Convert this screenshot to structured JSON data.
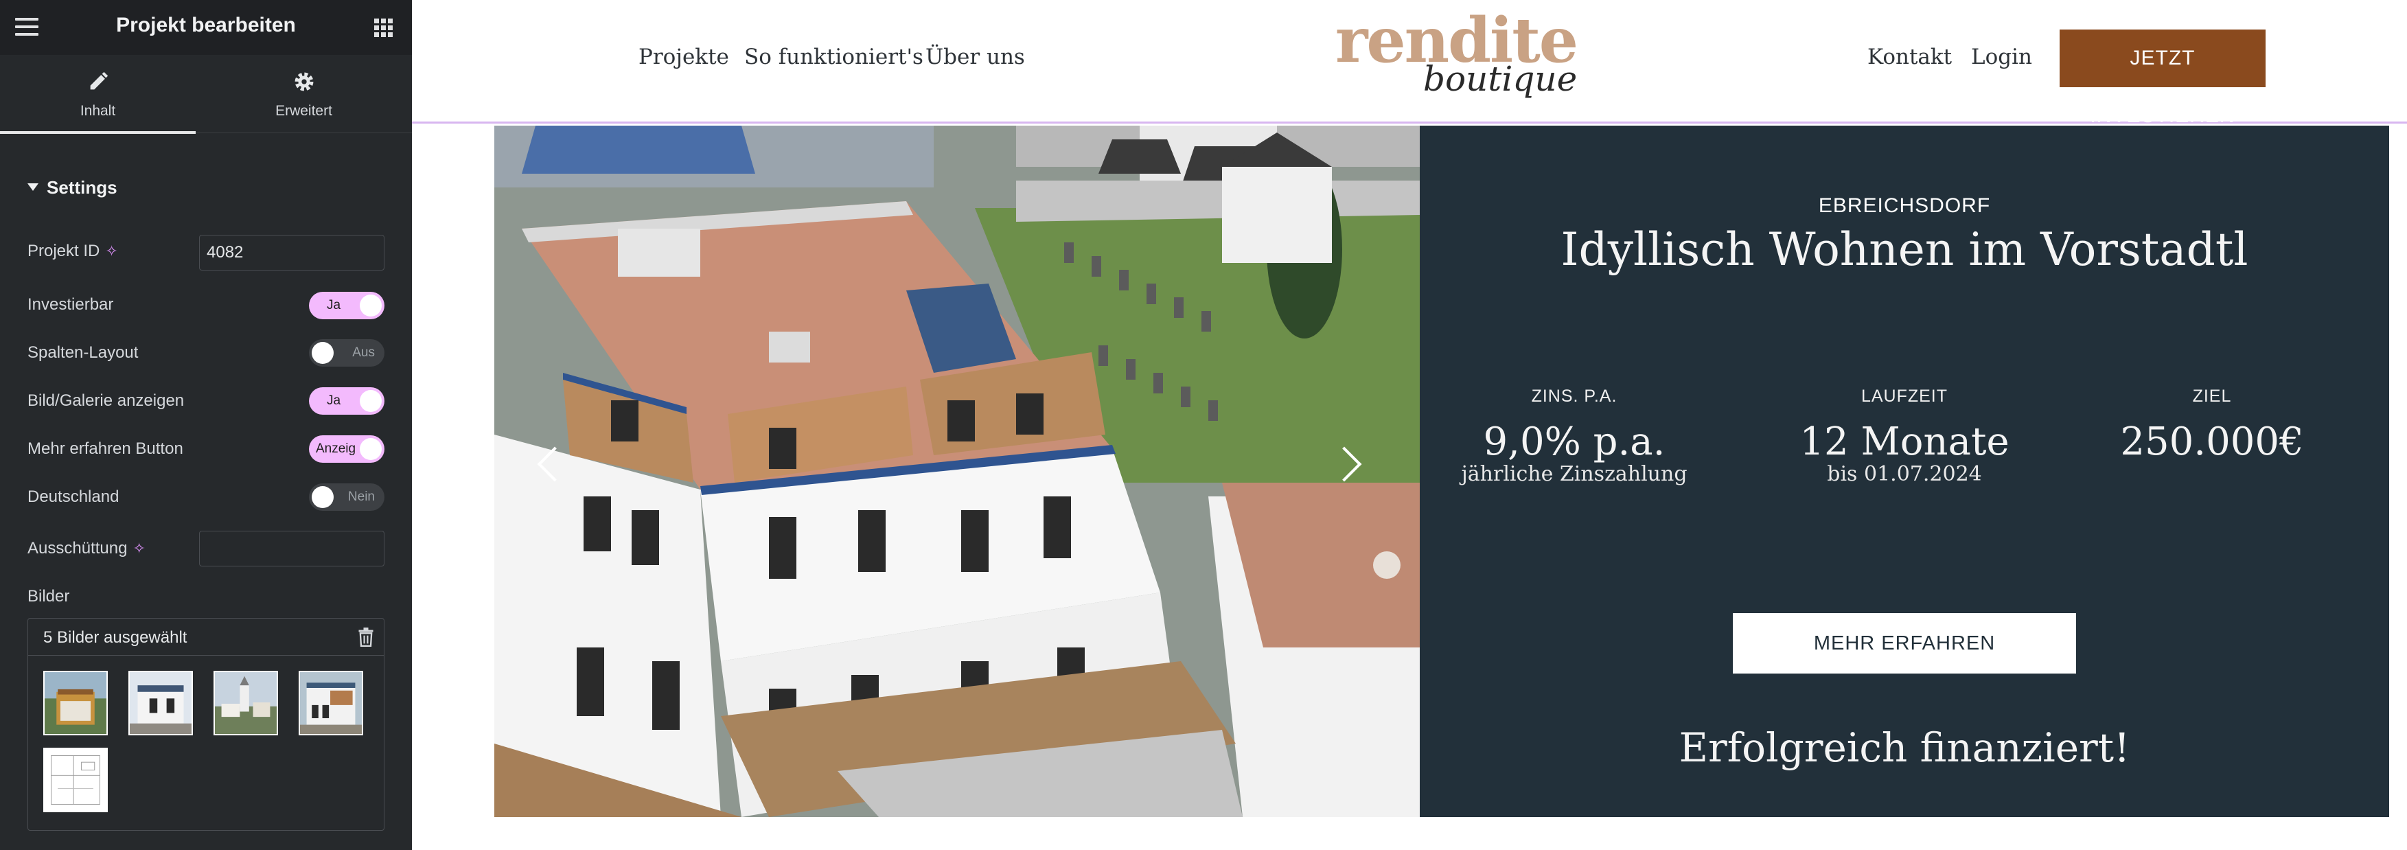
{
  "editor": {
    "title": "Projekt bearbeiten",
    "tabs": [
      {
        "label": "Inhalt",
        "icon": "pencil-icon",
        "active": true
      },
      {
        "label": "Erweitert",
        "icon": "gear-icon",
        "active": false
      }
    ],
    "section_title": "Settings",
    "fields": {
      "projekt_id": {
        "label": "Projekt ID",
        "value": "4082"
      },
      "investierbar": {
        "label": "Investierbar",
        "state": "Ja"
      },
      "spalten_layout": {
        "label": "Spalten-Layout",
        "state": "Aus"
      },
      "bild_galerie": {
        "label": "Bild/Galerie anzeigen",
        "state": "Ja"
      },
      "mehr_erfahren_button": {
        "label": "Mehr erfahren Button",
        "state": "Anzeig"
      },
      "deutschland": {
        "label": "Deutschland",
        "state": "Nein"
      },
      "ausschuettung": {
        "label": "Ausschüttung",
        "value": ""
      }
    },
    "bilder": {
      "label": "Bilder",
      "selected_text": "5 Bilder ausgewählt",
      "count": 5
    },
    "accent_color": "#f3bafd"
  },
  "site": {
    "nav_left": [
      "Projekte",
      "So funktioniert's",
      "Über uns"
    ],
    "logo": {
      "line1": "rendite",
      "line2": "boutique"
    },
    "nav_right": [
      "Kontakt",
      "Login"
    ],
    "cta": "JETZT INVESTIEREN",
    "project": {
      "location": "EBREICHSDORF",
      "title": "Idyllisch Wohnen im Vorstadtl",
      "stats": {
        "zins": {
          "label": "ZINS. P.A.",
          "value": "9,0% p.a.",
          "sub": "jährliche Zinszahlung"
        },
        "laufzeit": {
          "label": "LAUFZEIT",
          "value": "12 Monate",
          "sub": "bis 01.07.2024"
        },
        "ziel": {
          "label": "ZIEL",
          "value": "250.000€"
        }
      },
      "button": "MEHR ERFAHREN",
      "status": "Erfolgreich finanziert!"
    },
    "colors": {
      "panel": "#22303a",
      "cta": "#8a4a1e",
      "logo": "#c9a284"
    }
  }
}
